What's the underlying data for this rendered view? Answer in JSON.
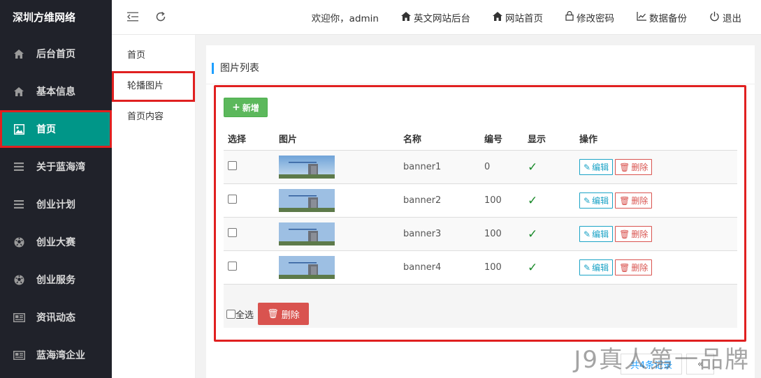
{
  "brand": "深圳方维网络",
  "sidebar": {
    "items": [
      {
        "label": "后台首页",
        "icon": "home-icon"
      },
      {
        "label": "基本信息",
        "icon": "home-icon"
      },
      {
        "label": "首页",
        "icon": "image-icon"
      },
      {
        "label": "关于蓝海湾",
        "icon": "menu-icon"
      },
      {
        "label": "创业计划",
        "icon": "menu-icon"
      },
      {
        "label": "创业大赛",
        "icon": "soccer-ball-icon"
      },
      {
        "label": "创业服务",
        "icon": "soccer-ball-icon"
      },
      {
        "label": "资讯动态",
        "icon": "newspaper-icon"
      },
      {
        "label": "蓝海湾企业",
        "icon": "newspaper-icon"
      }
    ]
  },
  "subnav": {
    "items": [
      {
        "label": "首页"
      },
      {
        "label": "轮播图片"
      },
      {
        "label": "首页内容"
      }
    ]
  },
  "header": {
    "welcome": "欢迎你，admin",
    "links": [
      {
        "label": "英文网站后台",
        "icon": "home-icon"
      },
      {
        "label": "网站首页",
        "icon": "home-icon"
      },
      {
        "label": "修改密码",
        "icon": "lock-icon"
      },
      {
        "label": "数据备份",
        "icon": "chart-line-icon"
      },
      {
        "label": "退出",
        "icon": "power-icon"
      }
    ]
  },
  "panel": {
    "title": "图片列表",
    "add_label": "新增",
    "columns": [
      "选择",
      "图片",
      "名称",
      "编号",
      "显示",
      "操作"
    ],
    "rows": [
      {
        "name": "banner1",
        "number": "0",
        "show": "✓"
      },
      {
        "name": "banner2",
        "number": "100",
        "show": "✓"
      },
      {
        "name": "banner3",
        "number": "100",
        "show": "✓"
      },
      {
        "name": "banner4",
        "number": "100",
        "show": "✓"
      }
    ],
    "edit_label": "编辑",
    "delete_label": "删除",
    "select_all_label": "全选",
    "bulk_delete_label": "删除"
  },
  "pagination": {
    "total_text": "共4条记录",
    "prev_text": "«"
  },
  "watermark": "J9真人第一品牌",
  "colors": {
    "sidebar_bg": "#20222a",
    "active_teal": "#009688",
    "highlight_red": "#e02020",
    "add_green": "#5cb85c",
    "delete_red": "#d9534f",
    "edit_cyan": "#1ba3c6",
    "title_accent_blue": "#1e9fff"
  }
}
